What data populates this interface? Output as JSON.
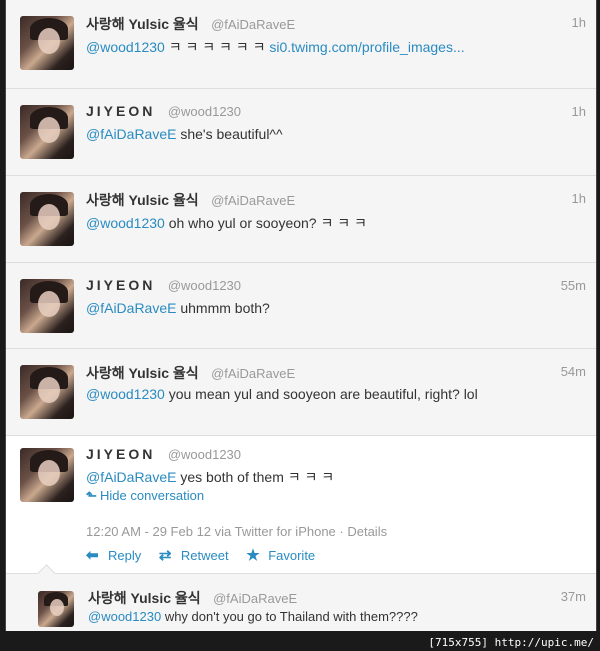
{
  "tweets": [
    {
      "fullname": "사랑해 Yulsic 율식",
      "handle": "@fAiDaRaveE",
      "time": "1h",
      "mention": "@wood1230",
      "body": " ㅋ ㅋ ㅋ ㅋ ㅋ ㅋ ",
      "link": "si0.twimg.com/profile_images..."
    },
    {
      "fullname": "JIYEON",
      "handle": "@wood1230",
      "time": "1h",
      "mention": "@fAiDaRaveE",
      "body": " she's beautiful^^"
    },
    {
      "fullname": "사랑해 Yulsic 율식",
      "handle": "@fAiDaRaveE",
      "time": "1h",
      "mention": "@wood1230",
      "body": " oh who yul or sooyeon? ㅋ ㅋ ㅋ"
    },
    {
      "fullname": "JIYEON",
      "handle": "@wood1230",
      "time": "55m",
      "mention": "@fAiDaRaveE",
      "body": " uhmmm both?"
    },
    {
      "fullname": "사랑해 Yulsic 율식",
      "handle": "@fAiDaRaveE",
      "time": "54m",
      "mention": "@wood1230",
      "body": " you mean yul and sooyeon are beautiful, right? lol"
    },
    {
      "fullname": "JIYEON",
      "handle": "@wood1230",
      "time": "",
      "mention": "@fAiDaRaveE",
      "body": " yes both of them ㅋ ㅋ ㅋ",
      "hide_conversation": "Hide conversation",
      "meta": "12:20 AM - 29 Feb 12 via Twitter for iPhone · Details",
      "actions": {
        "reply": "Reply",
        "retweet": "Retweet",
        "favorite": "Favorite"
      }
    },
    {
      "fullname": "사랑해 Yulsic 율식",
      "handle": "@fAiDaRaveE",
      "time": "37m",
      "mention": "@wood1230",
      "body": " why don't you go to Thailand with them????"
    }
  ],
  "watermark": "[715x755] http://upic.me/",
  "colors": {
    "link": "#2a8bc1",
    "muted": "#999999",
    "text": "#333333"
  }
}
